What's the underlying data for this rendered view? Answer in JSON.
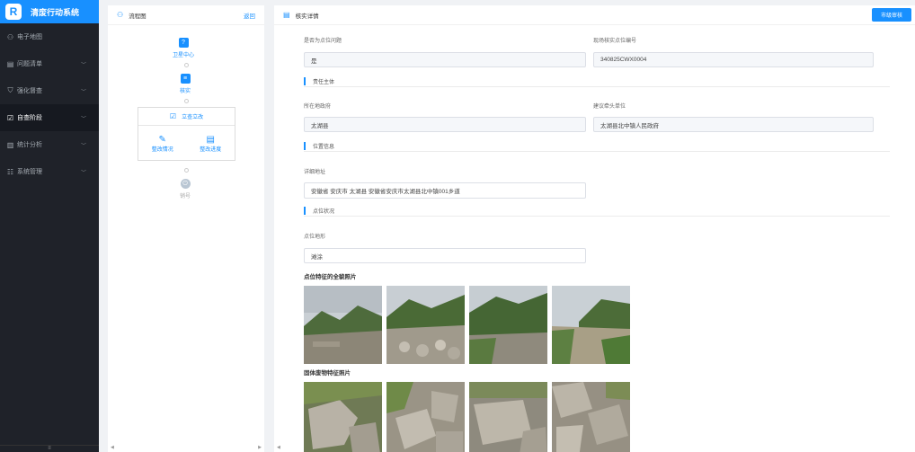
{
  "app": {
    "title": "清废行动系统",
    "logo_letter": "R"
  },
  "sidebar": {
    "items": [
      {
        "label": "电子地图",
        "icon": "user-icon",
        "has_chevron": false,
        "active": false
      },
      {
        "label": "问题清单",
        "icon": "list-icon",
        "has_chevron": true,
        "active": false
      },
      {
        "label": "强化督查",
        "icon": "shield-icon",
        "has_chevron": true,
        "active": false
      },
      {
        "label": "自查阶段",
        "icon": "checklist-icon",
        "has_chevron": true,
        "active": true
      },
      {
        "label": "统计分析",
        "icon": "chart-icon",
        "has_chevron": true,
        "active": false
      },
      {
        "label": "系统管理",
        "icon": "settings-icon",
        "has_chevron": true,
        "active": false
      }
    ]
  },
  "flow": {
    "title": "流程图",
    "back_label": "返回",
    "nodes": {
      "center": "卫星中心",
      "verify": "核实",
      "filing": "立查立改",
      "rectify_status": "整改情况",
      "rectify_progress": "整改进度",
      "sales": "销号"
    }
  },
  "detail": {
    "title": "核实详情",
    "review_button": "市级审核",
    "fields": {
      "is_problem_label": "是否为点位问题",
      "is_problem_value": "是",
      "point_code_label": "现场核实点位编号",
      "point_code_value": "340825CWX0004",
      "gov_label": "所在地政府",
      "gov_value": "太湖县",
      "lead_unit_label": "建议牵头单位",
      "lead_unit_value": "太湖县北中镇人民政府",
      "address_label": "详细地址",
      "address_value": "安徽省 安庆市 太湖县 安徽省安庆市太湖县北中镇001乡道",
      "terrain_label": "点位地形",
      "terrain_value": "滩涂"
    },
    "sections": {
      "responsibility": "责任主体",
      "location": "位置信息",
      "status": "点位状况"
    },
    "photos": {
      "panorama_label": "点位特征的全貌照片",
      "waste_label": "固体废物特征照片"
    }
  },
  "colors": {
    "accent": "#1890ff",
    "sidebar_bg": "#1f2229"
  }
}
